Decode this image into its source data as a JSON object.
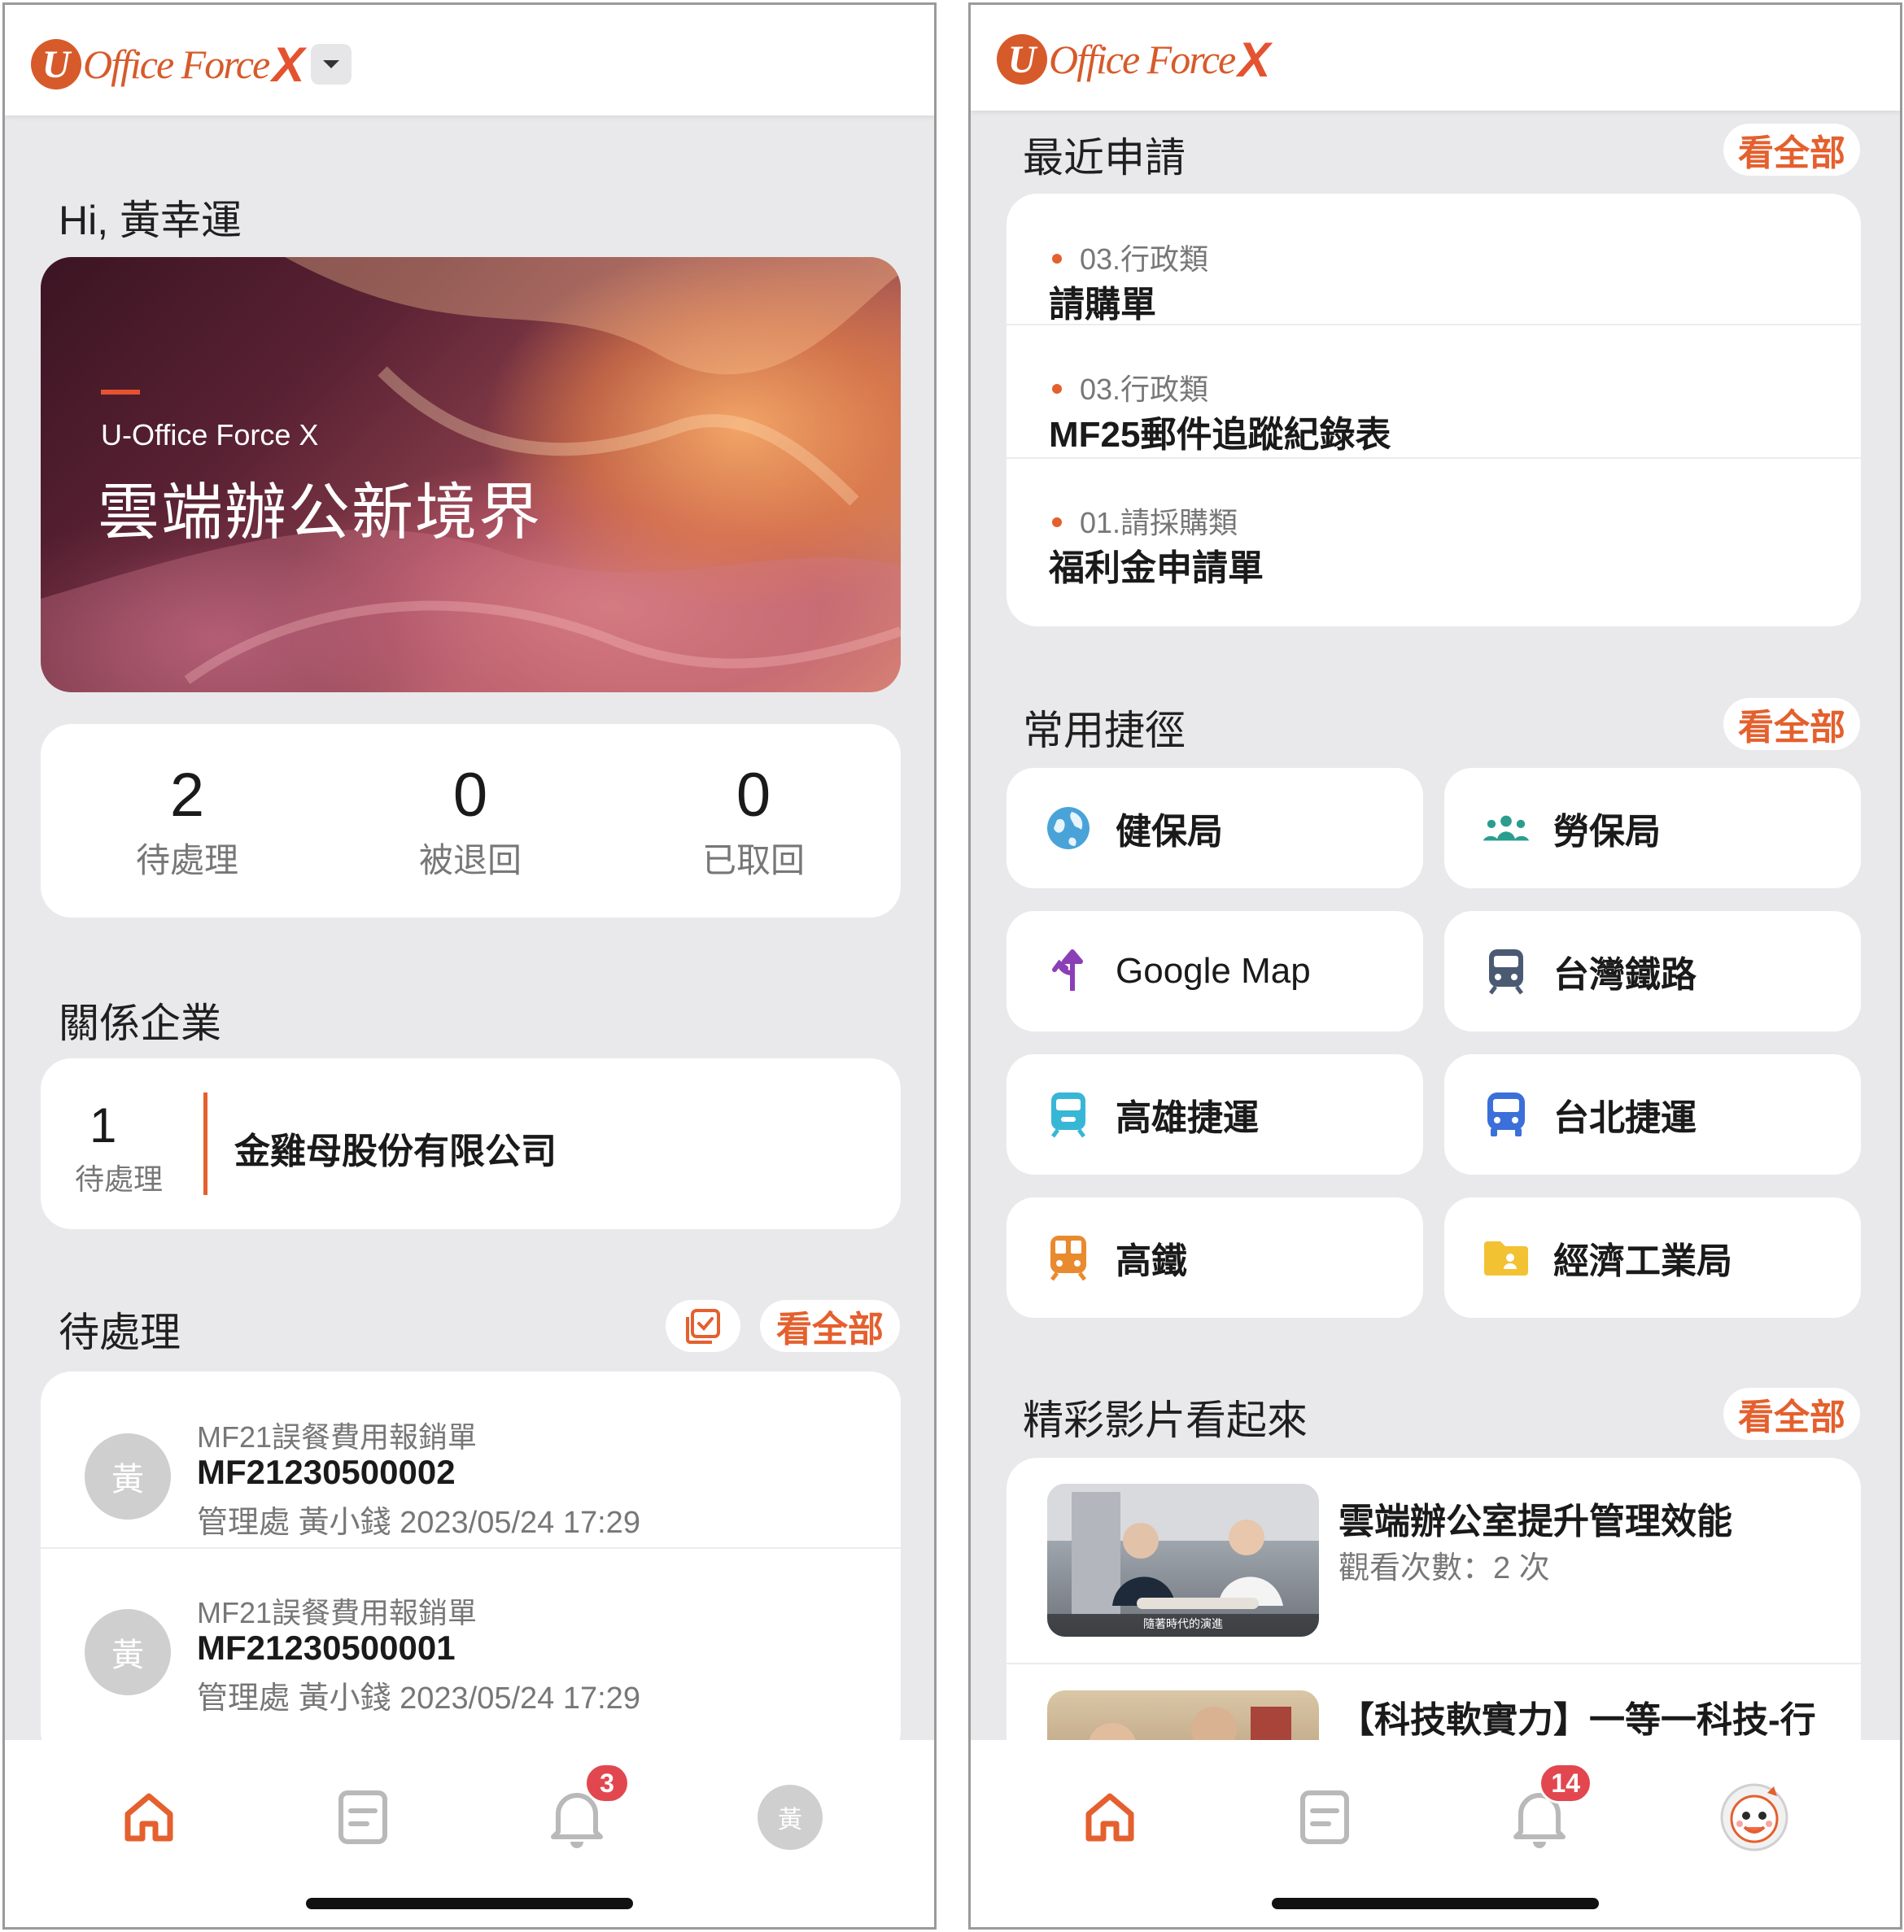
{
  "brand": {
    "logo_mark": "U",
    "logo_text": "Office Force",
    "logo_x": "X",
    "accent": "#e4602e"
  },
  "left": {
    "greeting": "Hi, 黃幸運",
    "hero": {
      "subtitle": "U-Office Force X",
      "title": "雲端辦公新境界"
    },
    "stats": [
      {
        "value": "2",
        "label": "待處理"
      },
      {
        "value": "0",
        "label": "被退回"
      },
      {
        "value": "0",
        "label": "已取回"
      }
    ],
    "affiliates": {
      "title": "關係企業",
      "count": "1",
      "count_label": "待處理",
      "company": "金雞母股份有限公司"
    },
    "pending": {
      "title": "待處理",
      "view_all": "看全部",
      "items": [
        {
          "avatar": "黃",
          "type": "MF21誤餐費用報銷單",
          "id": "MF21230500002",
          "meta": "管理處 黃小錢 2023/05/24 17:29"
        },
        {
          "avatar": "黃",
          "type": "MF21誤餐費用報銷單",
          "id": "MF21230500001",
          "meta": "管理處 黃小錢 2023/05/24 17:29"
        }
      ]
    },
    "nav": {
      "badge": "3",
      "avatar": "黃"
    }
  },
  "right": {
    "recent": {
      "title": "最近申請",
      "view_all": "看全部",
      "items": [
        {
          "category": "03.行政類",
          "name": "請購單"
        },
        {
          "category": "03.行政類",
          "name": "MF25郵件追蹤紀錄表"
        },
        {
          "category": "01.請採購類",
          "name": "福利金申請單"
        }
      ]
    },
    "shortcuts": {
      "title": "常用捷徑",
      "view_all": "看全部",
      "items": [
        {
          "label": "健保局",
          "icon": "globe-icon",
          "color": "#4aa3d8"
        },
        {
          "label": "勞保局",
          "icon": "people-icon",
          "color": "#2a9d8f"
        },
        {
          "label": "Google Map",
          "icon": "directions-icon",
          "color": "#8b3fb6"
        },
        {
          "label": "台灣鐵路",
          "icon": "train-icon",
          "color": "#4a5a72"
        },
        {
          "label": "高雄捷運",
          "icon": "metro-icon",
          "color": "#38b6d6"
        },
        {
          "label": "台北捷運",
          "icon": "bus-icon",
          "color": "#3b6fd9"
        },
        {
          "label": "高鐵",
          "icon": "rail-icon",
          "color": "#e98a2e"
        },
        {
          "label": "經濟工業局",
          "icon": "folder-icon",
          "color": "#f2c233"
        }
      ]
    },
    "videos": {
      "title": "精彩影片看起來",
      "view_all": "看全部",
      "items": [
        {
          "title": "雲端辦公室提升管理效能",
          "views": "觀看次數：2 次",
          "caption": "隨著時代的演進"
        },
        {
          "title": "【科技軟實力】一等一科技-行"
        }
      ]
    },
    "nav": {
      "badge": "14"
    }
  }
}
